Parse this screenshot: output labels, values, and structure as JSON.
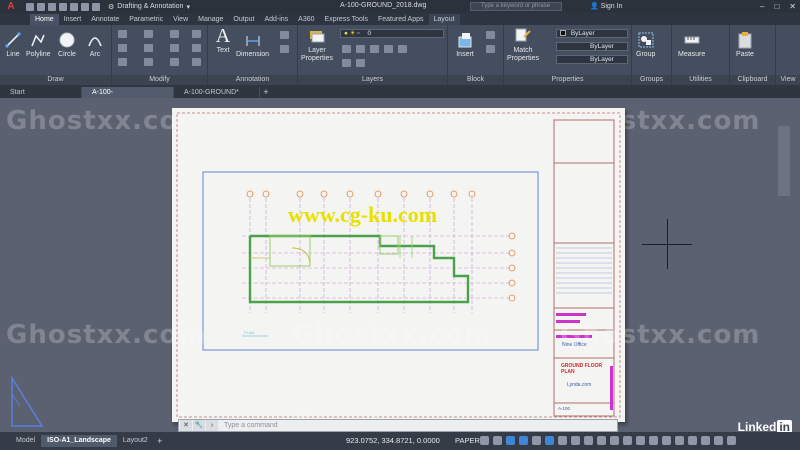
{
  "app": {
    "logo": "A",
    "workspace": "Drafting & Annotation",
    "window_title": "A-100-GROUND_2018.dwg",
    "search_placeholder": "Type a keyword or phrase",
    "signin": "Sign In"
  },
  "ribbon_tabs": [
    "Home",
    "Insert",
    "Annotate",
    "Parametric",
    "View",
    "Manage",
    "Output",
    "Add-ins",
    "A360",
    "Express Tools",
    "Featured Apps",
    "Layout"
  ],
  "ribbon": {
    "draw": {
      "title": "Draw",
      "tools": [
        "Line",
        "Polyline",
        "Circle",
        "Arc"
      ]
    },
    "modify": {
      "title": "Modify"
    },
    "annotation": {
      "title": "Annotation",
      "tools": [
        "Text",
        "Dimension"
      ]
    },
    "layers": {
      "title": "Layers",
      "tool": "Layer Properties",
      "layer_value": "0"
    },
    "block": {
      "title": "Block",
      "tool": "Insert"
    },
    "properties": {
      "title": "Properties",
      "tool": "Match Properties",
      "color": "ByLayer",
      "linetype": "ByLayer",
      "lineweight": "ByLayer"
    },
    "groups": {
      "title": "Groups",
      "tool": "Group"
    },
    "utilities": {
      "title": "Utilities",
      "tool": "Measure"
    },
    "clipboard": {
      "title": "Clipboard",
      "tool": "Paste"
    },
    "view": {
      "title": "View"
    }
  },
  "file_tabs": [
    "Start",
    "A-100-GROUND_2018*",
    "A-100-GROUND*"
  ],
  "drawing": {
    "center_watermark": "www.cg-ku.com",
    "watermark": "Ghostxx.com",
    "titleblock_company": "Nine Office",
    "titleblock_title": "GROUND FLOOR PLAN",
    "titleblock_site": "Lynda.com",
    "sheet": "A-100"
  },
  "command_line": {
    "placeholder": "Type a command"
  },
  "layout_tabs": [
    "Model",
    "ISO-A1_Landscape",
    "Layout2"
  ],
  "status": {
    "coordinates": "923.0752, 334.8721, 0.0000",
    "space": "PAPER"
  },
  "brand": "Linked"
}
